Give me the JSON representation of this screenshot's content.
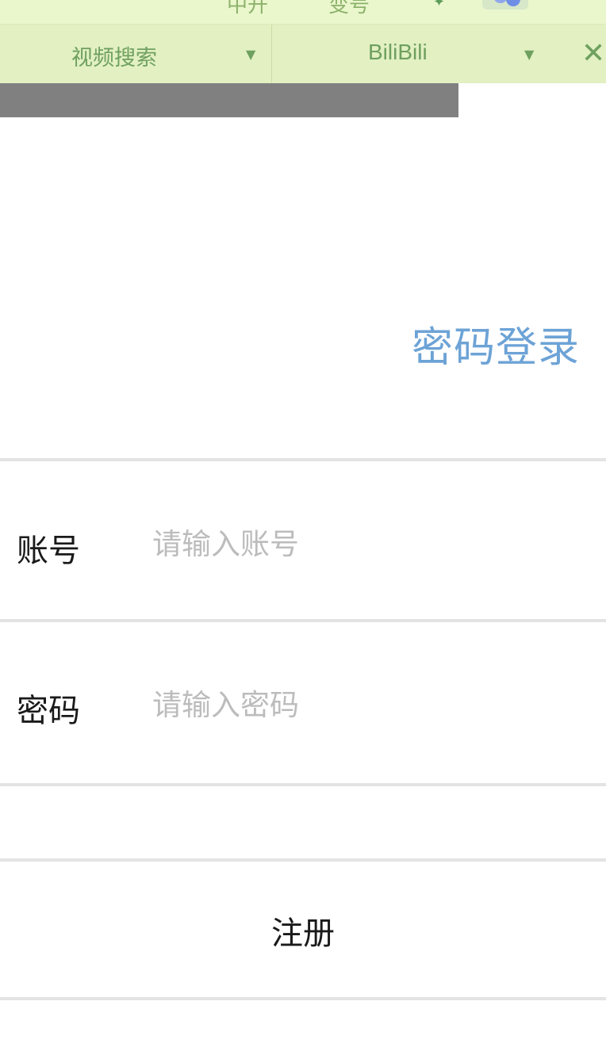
{
  "top_strip": {
    "cut_text_1": "中开",
    "cut_text_2": "变号"
  },
  "toolbar": {
    "search_type": "视频搜索",
    "source": "BiliBili",
    "close_symbol": "✕"
  },
  "progress": {
    "fraction": 0.756,
    "color": "#808080"
  },
  "login": {
    "title": "密码登录",
    "title_color": "#6da3d6",
    "account_label": "账号",
    "account_placeholder": "请输入账号",
    "password_label": "密码",
    "password_placeholder": "请输入密码",
    "register_label": "注册"
  },
  "icons": {
    "sparkle": "sparkle-icon",
    "help": "help-badge-icon",
    "caret": "caret-down-icon",
    "close": "close-icon"
  }
}
